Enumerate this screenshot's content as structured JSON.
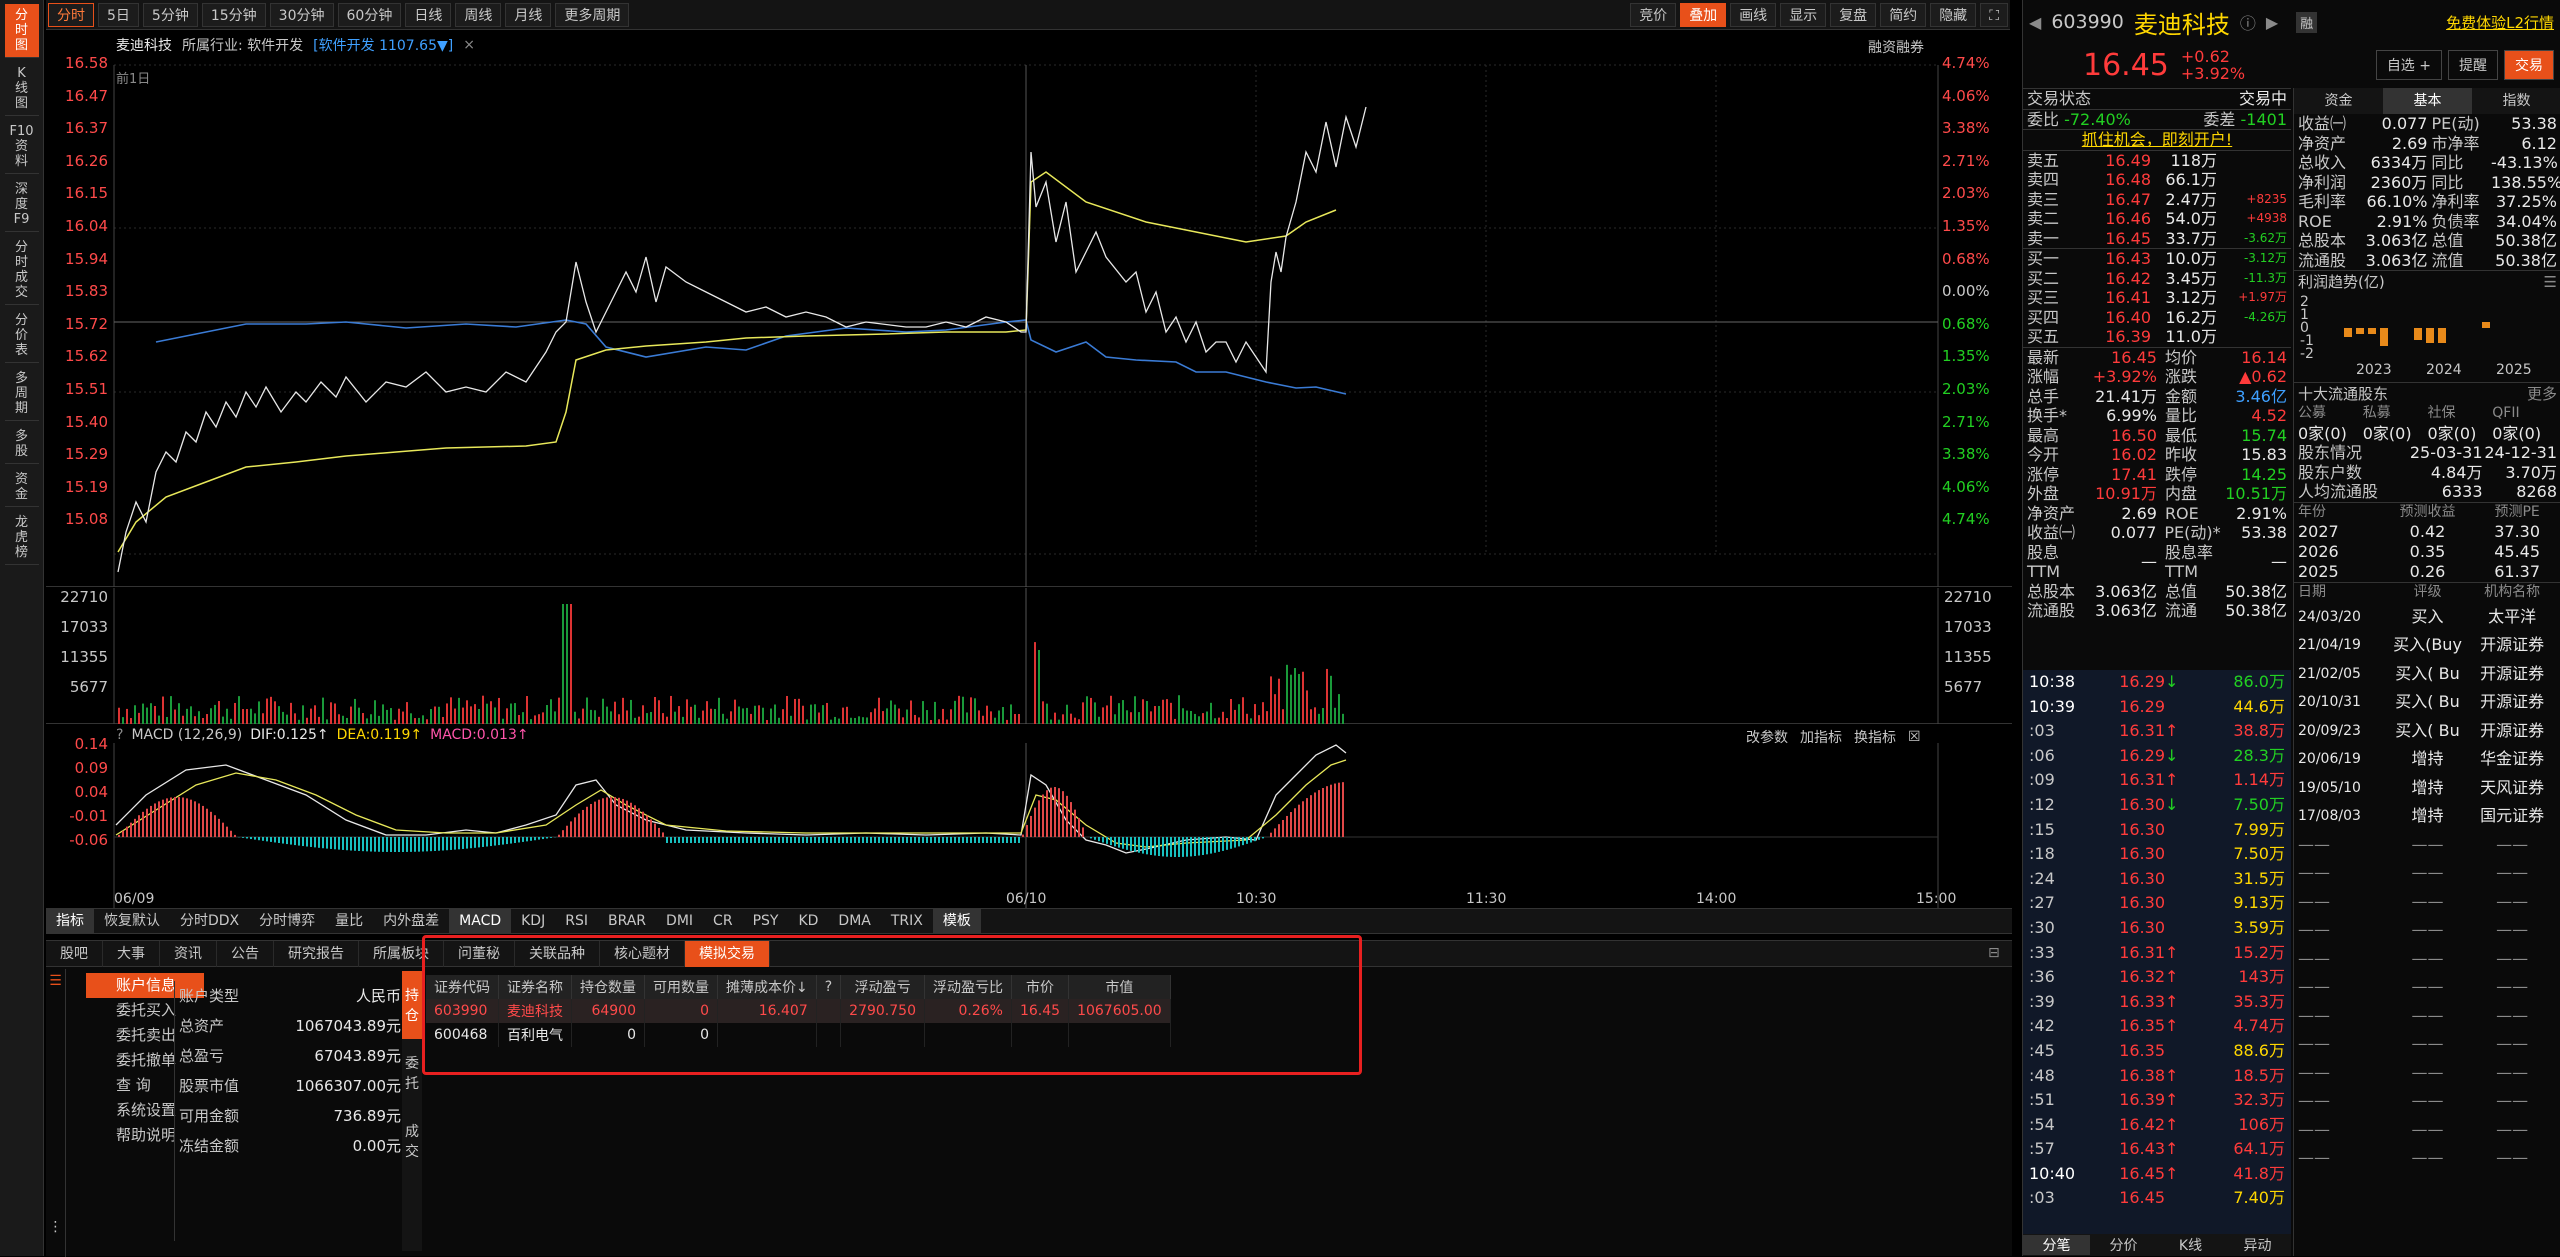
{
  "left_nav": [
    {
      "label": "分\n时\n图",
      "active": true
    },
    {
      "label": "K\n线\n图"
    },
    {
      "label": "F10\n资\n料"
    },
    {
      "label": "深\n度\nF9"
    },
    {
      "label": "分\n时\n成\n交"
    },
    {
      "label": "分\n价\n表"
    },
    {
      "label": "多\n周\n期"
    },
    {
      "label": "多\n股"
    },
    {
      "label": "资\n金"
    },
    {
      "label": "龙\n虎\n榜"
    }
  ],
  "toolbar": {
    "periods": [
      "分时",
      "5日",
      "5分钟",
      "15分钟",
      "30分钟",
      "60分钟",
      "日线",
      "周线",
      "月线",
      "更多周期"
    ],
    "right": [
      "竞价",
      "叠加",
      "画线",
      "显示",
      "复盘",
      "简约",
      "隐藏"
    ]
  },
  "stock_header": {
    "name": "麦迪科技",
    "industry": "所属行业: 软件开发",
    "sector": "[软件开发 1107.65▼]",
    "right_label": "融资融券",
    "prev_day": "前1日"
  },
  "chart": {
    "price_ticks": [
      "16.58",
      "16.47",
      "16.37",
      "16.26",
      "16.15",
      "16.04",
      "15.94",
      "15.83",
      "15.72",
      "15.62",
      "15.51",
      "15.40",
      "15.29",
      "15.19",
      "15.08"
    ],
    "pct_ticks": [
      "4.74%",
      "4.06%",
      "3.38%",
      "2.71%",
      "2.03%",
      "1.35%",
      "0.68%",
      "0.00%",
      "0.68%",
      "1.35%",
      "2.03%",
      "2.71%",
      "3.38%",
      "4.06%",
      "4.74%"
    ],
    "vol_ticks": [
      "22710",
      "17033",
      "11355",
      "5677"
    ],
    "macd_ticks": [
      "0.14",
      "0.09",
      "0.04",
      "-0.01",
      "-0.06",
      "-0.06"
    ],
    "macd_header": "MACD (12,26,9)",
    "dif": "DIF:0.125↑",
    "dea": "DEA:0.119↑",
    "macd": "MACD:0.013↑",
    "macd_right": [
      "改参数",
      "加指标",
      "换指标"
    ],
    "time_labels": [
      "06/09",
      "06/10",
      "10:30",
      "11:30",
      "14:00",
      "15:00"
    ]
  },
  "chart_data": {
    "type": "line",
    "x": [
      "06/09",
      "06/10"
    ],
    "series": [],
    "ylim": [
      15.08,
      16.58
    ]
  },
  "indicator_tabs": [
    "指标",
    "恢复默认",
    "分时DDX",
    "分时博弈",
    "量比",
    "内外盘差",
    "MACD",
    "KDJ",
    "RSI",
    "BRAR",
    "DMI",
    "CR",
    "PSY",
    "KD",
    "DMA",
    "TRIX",
    "模板"
  ],
  "bottom": {
    "tabs": [
      "股吧",
      "大事",
      "资讯",
      "公告",
      "研究报告",
      "所属板块",
      "问董秘",
      "关联品种",
      "核心题材",
      "模拟交易"
    ],
    "menu": [
      "账户信息",
      "委托买入",
      "委托卖出",
      "委托撤单",
      "查 询",
      "系统设置",
      "帮助说明"
    ],
    "account": [
      [
        "账户类型",
        "人民币"
      ],
      [
        "总资产",
        "1067043.89元"
      ],
      [
        "总盈亏",
        "67043.89元"
      ],
      [
        "股票市值",
        "1066307.00元"
      ],
      [
        "可用金额",
        "736.89元"
      ],
      [
        "冻结金额",
        "0.00元"
      ]
    ],
    "side_tabs": [
      "持\n仓",
      "委\n托",
      "成\n交"
    ],
    "table_headers": [
      "证券代码",
      "证券名称",
      "持仓数量",
      "可用数量",
      "摊薄成本价↓",
      "?",
      "浮动盈亏",
      "浮动盈亏比",
      "市价",
      "市值"
    ],
    "rows": [
      [
        "603990",
        "麦迪科技",
        "64900",
        "0",
        "16.407",
        "",
        "2790.750",
        "0.26%",
        "16.45",
        "1067605.00"
      ],
      [
        "600468",
        "百利电气",
        "0",
        "0",
        "",
        "",
        "",
        "",
        "",
        ""
      ]
    ]
  },
  "quote": {
    "code": "603990",
    "name": "麦迪科技",
    "price": "16.45",
    "change": "+0.62",
    "change_pct": "+3.92%",
    "badge": "融",
    "l2": "免费体验L2行情",
    "btns": [
      "自选 +",
      "提醒",
      "交易"
    ],
    "status_l": "交易状态",
    "status_r": "交易中",
    "weibi": "-72.40%",
    "weicha": "-1401",
    "promo": "抓住机会，即刻开户!",
    "asks": [
      [
        "卖五",
        "16.49",
        "118万",
        ""
      ],
      [
        "卖四",
        "16.48",
        "66.1万",
        ""
      ],
      [
        "卖三",
        "16.47",
        "2.47万",
        "+8235"
      ],
      [
        "卖二",
        "16.46",
        "54.0万",
        "+4938"
      ],
      [
        "卖一",
        "16.45",
        "33.7万",
        "-3.62万"
      ]
    ],
    "bids": [
      [
        "买一",
        "16.43",
        "10.0万",
        "-3.12万"
      ],
      [
        "买二",
        "16.42",
        "3.45万",
        "-11.3万"
      ],
      [
        "买三",
        "16.41",
        "3.12万",
        "+1.97万"
      ],
      [
        "买四",
        "16.40",
        "16.2万",
        "-4.26万"
      ],
      [
        "买五",
        "16.39",
        "11.0万",
        ""
      ]
    ],
    "stats": [
      [
        "最新",
        "16.45",
        "均价",
        "16.14"
      ],
      [
        "涨幅",
        "+3.92%",
        "涨跌",
        "▲0.62"
      ],
      [
        "总手",
        "21.41万",
        "金额",
        "3.46亿"
      ],
      [
        "换手*",
        "6.99%",
        "量比",
        "4.52"
      ],
      [
        "最高",
        "16.50",
        "最低",
        "15.74"
      ],
      [
        "今开",
        "16.02",
        "昨收",
        "15.83"
      ],
      [
        "涨停",
        "17.41",
        "跌停",
        "14.25"
      ],
      [
        "外盘",
        "10.91万",
        "内盘",
        "10.51万"
      ],
      [
        "净资产",
        "2.69",
        "ROE",
        "2.91%"
      ],
      [
        "收益㈠",
        "0.077",
        "PE(动)*",
        "53.38"
      ],
      [
        "股息TTM",
        "—",
        "股息率TTM",
        "—"
      ],
      [
        "总股本",
        "3.063亿",
        "总值",
        "50.38亿"
      ],
      [
        "流通股",
        "3.063亿",
        "流通",
        "50.38亿"
      ]
    ],
    "ticks": [
      [
        "10:38",
        "16.29",
        "86.0万",
        "d"
      ],
      [
        "10:39",
        "16.29",
        "44.6万",
        ""
      ],
      [
        ":03",
        "16.31",
        "38.8万",
        "u"
      ],
      [
        ":06",
        "16.29",
        "28.3万",
        "d"
      ],
      [
        ":09",
        "16.31",
        "1.14万",
        "u"
      ],
      [
        ":12",
        "16.30",
        "7.50万",
        "d"
      ],
      [
        ":15",
        "16.30",
        "7.99万",
        ""
      ],
      [
        ":18",
        "16.30",
        "7.50万",
        ""
      ],
      [
        ":24",
        "16.30",
        "31.5万",
        ""
      ],
      [
        ":27",
        "16.30",
        "9.13万",
        ""
      ],
      [
        ":30",
        "16.30",
        "3.59万",
        ""
      ],
      [
        ":33",
        "16.31",
        "15.2万",
        "u"
      ],
      [
        ":36",
        "16.32",
        "143万",
        "u"
      ],
      [
        ":39",
        "16.33",
        "35.3万",
        "u"
      ],
      [
        ":42",
        "16.35",
        "4.74万",
        "u"
      ],
      [
        ":45",
        "16.35",
        "88.6万",
        ""
      ],
      [
        ":48",
        "16.38",
        "18.5万",
        "u"
      ],
      [
        ":51",
        "16.39",
        "32.3万",
        "u"
      ],
      [
        ":54",
        "16.42",
        "106万",
        "u"
      ],
      [
        ":57",
        "16.43",
        "64.1万",
        "u"
      ],
      [
        "10:40",
        "16.45",
        "41.8万",
        "u"
      ],
      [
        ":03",
        "16.45",
        "7.40万",
        ""
      ]
    ],
    "tick_tabs": [
      "分笔",
      "分价",
      "K线",
      "异动"
    ]
  },
  "fund": {
    "tabs": [
      "资金",
      "基本",
      "指数"
    ],
    "rows": [
      [
        "收益㈠",
        "0.077",
        "PE(动)",
        "53.38"
      ],
      [
        "净资产",
        "2.69",
        "市净率",
        "6.12"
      ],
      [
        "总收入",
        "6334万",
        "同比",
        "-43.13%"
      ],
      [
        "净利润",
        "2360万",
        "同比",
        "138.55%"
      ],
      [
        "毛利率",
        "66.10%",
        "净利率",
        "37.25%"
      ],
      [
        "ROE",
        "2.91%",
        "负债率",
        "34.04%"
      ],
      [
        "总股本",
        "3.063亿",
        "总值",
        "50.38亿"
      ],
      [
        "流通股",
        "3.063亿",
        "流值",
        "50.38亿"
      ]
    ],
    "trend_title": "利润趋势(亿)",
    "trend_years": [
      "2023",
      "2024",
      "2025"
    ],
    "trend_y": [
      "2",
      "1",
      "0",
      "-1",
      "-2"
    ],
    "holders_title": "十大流通股东",
    "more": "更多",
    "holder_cols": [
      "公募",
      "私募",
      "社保",
      "QFII"
    ],
    "holder_vals": [
      "0家(0)",
      "0家(0)",
      "0家(0)",
      "0家(0)"
    ],
    "holder_rows": [
      [
        "股东情况",
        "25-03-31",
        "24-12-31"
      ],
      [
        "股东户数",
        "4.84万",
        "3.70万"
      ],
      [
        "人均流通股",
        "6333",
        "8268"
      ]
    ],
    "forecast_head": [
      "年份",
      "预测收益",
      "预测PE"
    ],
    "forecast": [
      [
        "2027",
        "0.42",
        "37.30"
      ],
      [
        "2026",
        "0.35",
        "45.45"
      ],
      [
        "2025",
        "0.26",
        "61.37"
      ]
    ],
    "rating_head": [
      "日期",
      "评级",
      "机构名称"
    ],
    "ratings": [
      [
        "24/03/20",
        "买入",
        "太平洋"
      ],
      [
        "21/04/19",
        "买入(Buy",
        "开源证券"
      ],
      [
        "21/02/05",
        "买入( Bu",
        "开源证券"
      ],
      [
        "20/10/31",
        "买入( Bu",
        "开源证券"
      ],
      [
        "20/09/23",
        "买入( Bu",
        "开源证券"
      ],
      [
        "20/06/19",
        "增持",
        "华金证券"
      ],
      [
        "19/05/10",
        "增持",
        "天风证券"
      ],
      [
        "17/08/03",
        "增持",
        "国元证券"
      ]
    ]
  }
}
